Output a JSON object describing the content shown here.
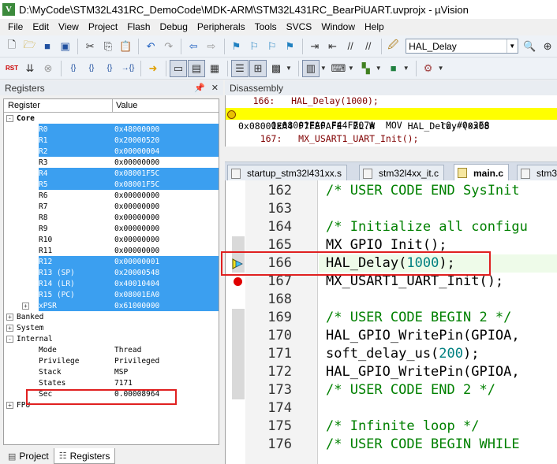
{
  "window": {
    "icon_letter": "V",
    "title": "D:\\MyCode\\STM32L431RC_DemoCode\\MDK-ARM\\STM32L431RC_BearPiUART.uvprojx - µVision"
  },
  "menu": [
    "File",
    "Edit",
    "View",
    "Project",
    "Flash",
    "Debug",
    "Peripherals",
    "Tools",
    "SVCS",
    "Window",
    "Help"
  ],
  "toolbar": {
    "function_combo_value": "HAL_Delay",
    "rst_label": "RST",
    "braces_1": "{}",
    "braces_2": "{}",
    "braces_3": "{}"
  },
  "registers_panel": {
    "title": "Registers",
    "col_register": "Register",
    "col_value": "Value",
    "groups": {
      "core": "Core",
      "banked": "Banked",
      "system": "System",
      "internal": "Internal",
      "fpu": "FPU"
    },
    "core_regs": [
      {
        "name": "R0",
        "value": "0x48000000"
      },
      {
        "name": "R1",
        "value": "0x20000520"
      },
      {
        "name": "R2",
        "value": "0x00000004"
      },
      {
        "name": "R3",
        "value": "0x00000000"
      },
      {
        "name": "R4",
        "value": "0x08001F5C"
      },
      {
        "name": "R5",
        "value": "0x08001F5C"
      },
      {
        "name": "R6",
        "value": "0x00000000"
      },
      {
        "name": "R7",
        "value": "0x00000000"
      },
      {
        "name": "R8",
        "value": "0x00000000"
      },
      {
        "name": "R9",
        "value": "0x00000000"
      },
      {
        "name": "R10",
        "value": "0x00000000"
      },
      {
        "name": "R11",
        "value": "0x00000000"
      },
      {
        "name": "R12",
        "value": "0x00000001"
      },
      {
        "name": "R13 (SP)",
        "value": "0x20000548"
      },
      {
        "name": "R14 (LR)",
        "value": "0x40010404"
      },
      {
        "name": "R15 (PC)",
        "value": "0x08001EA0"
      },
      {
        "name": "xPSR",
        "value": "0x61000000"
      }
    ],
    "internal_regs": [
      {
        "name": "Mode",
        "value": "Thread"
      },
      {
        "name": "Privilege",
        "value": "Privileged"
      },
      {
        "name": "Stack",
        "value": "MSP"
      },
      {
        "name": "States",
        "value": "7171"
      },
      {
        "name": "Sec",
        "value": "0.00008964"
      }
    ]
  },
  "bottom_tabs": {
    "project": "Project",
    "registers": "Registers"
  },
  "disassembly": {
    "title": "Disassembly",
    "lines": [
      "     166:   HAL_Delay(1000);",
      "0x08001EA0 F44F707A  MOV       r0,#0x3E8",
      "0x08001EA4 F7FEFAFE  BL.W      HAL_Delay (0x08",
      "    167:   MX_USART1_UART_Init();"
    ]
  },
  "editor_tabs": [
    "startup_stm32l431xx.s",
    "stm32l4xx_it.c",
    "main.c",
    "stm3"
  ],
  "code": {
    "lines": [
      {
        "n": "162",
        "text": "/* USER CODE END SysInit"
      },
      {
        "n": "163",
        "text": ""
      },
      {
        "n": "164",
        "text": "/* Initialize all configu"
      },
      {
        "n": "165",
        "text": "MX_GPIO_Init();"
      },
      {
        "n": "166",
        "pre": "HAL_Delay(",
        "num": "1000",
        "post": ");"
      },
      {
        "n": "167",
        "text": "MX_USART1_UART_Init();"
      },
      {
        "n": "168",
        "text": ""
      },
      {
        "n": "169",
        "text": "/* USER CODE BEGIN 2 */"
      },
      {
        "n": "170",
        "text": "HAL_GPIO_WritePin(GPIOA,"
      },
      {
        "n": "171",
        "pre": "soft_delay_us(",
        "num": "200",
        "post": ");"
      },
      {
        "n": "172",
        "text": "HAL_GPIO_WritePin(GPIOA,"
      },
      {
        "n": "173",
        "text": "/* USER CODE END 2 */"
      },
      {
        "n": "174",
        "text": ""
      },
      {
        "n": "175",
        "text": "/* Infinite loop */"
      },
      {
        "n": "176",
        "text": "/* USER CODE BEGIN WHILE"
      }
    ]
  },
  "colors": {
    "selection": "#3b9ff0",
    "comment": "#008000",
    "number": "#008080",
    "highlight_box": "#e02020",
    "current_line": "#ffff00"
  }
}
